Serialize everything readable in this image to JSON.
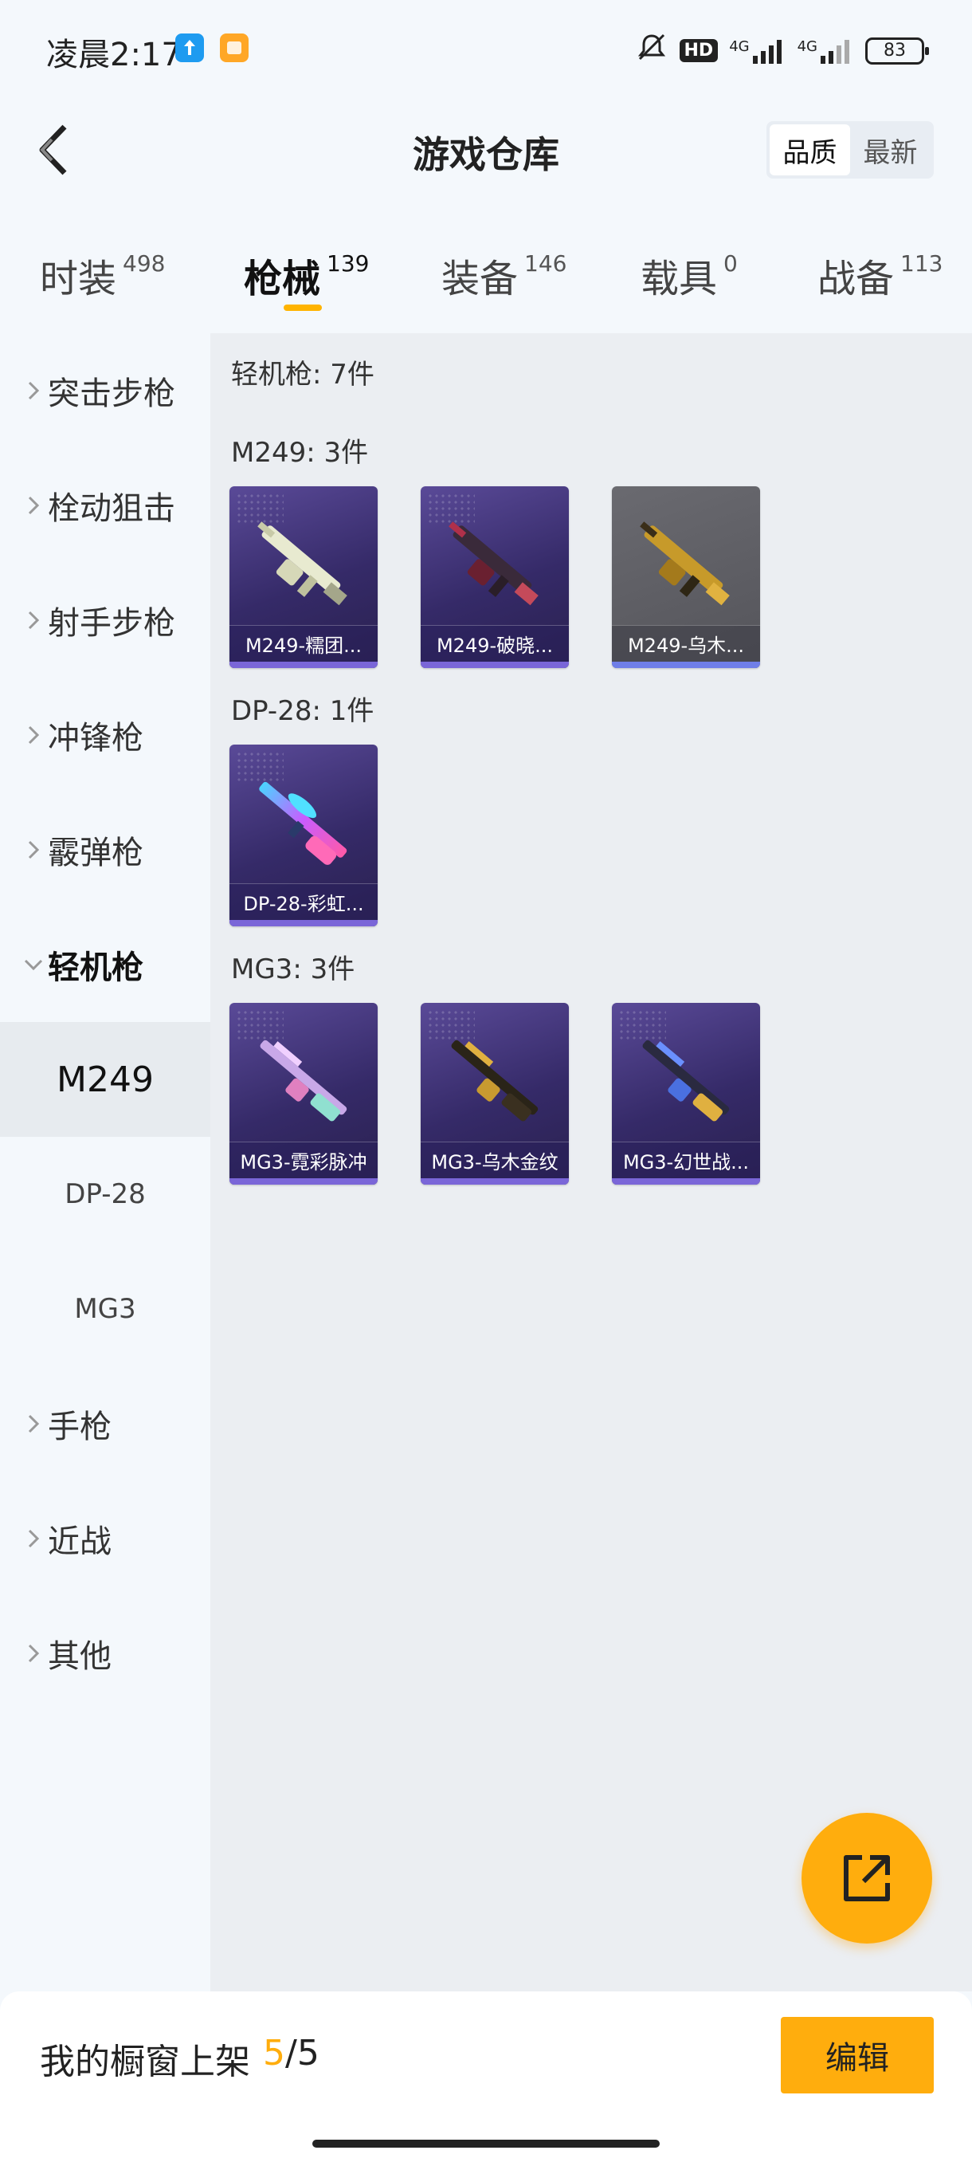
{
  "status": {
    "time": "凌晨2:17",
    "hd": "HD",
    "net1": "4G",
    "net2": "4G",
    "battery": "83"
  },
  "header": {
    "title": "游戏仓库",
    "sort": {
      "quality": "品质",
      "newest": "最新"
    }
  },
  "tabs": [
    {
      "label": "时装",
      "count": "498"
    },
    {
      "label": "枪械",
      "count": "139"
    },
    {
      "label": "装备",
      "count": "146"
    },
    {
      "label": "载具",
      "count": "0"
    },
    {
      "label": "战备",
      "count": "113"
    }
  ],
  "sidebar": {
    "categories": [
      "突击步枪",
      "栓动狙击",
      "射手步枪",
      "冲锋枪",
      "霰弹枪",
      "轻机枪",
      "手枪",
      "近战",
      "其他"
    ],
    "subitems": [
      "M249",
      "DP-28",
      "MG3"
    ]
  },
  "content": {
    "category_header": "轻机枪: 7件",
    "groups": [
      {
        "title": "M249: 3件",
        "items": [
          "M249-糯团...",
          "M249-破晓...",
          "M249-乌木..."
        ]
      },
      {
        "title": "DP-28: 1件",
        "items": [
          "DP-28-彩虹..."
        ]
      },
      {
        "title": "MG3: 3件",
        "items": [
          "MG3-霓彩脉冲",
          "MG3-乌木金纹",
          "MG3-幻世战..."
        ]
      }
    ]
  },
  "bottom": {
    "showcase_label": "我的橱窗上架",
    "showcase_current": "5",
    "showcase_total": "/5",
    "edit_label": "编辑"
  },
  "colors": {
    "accent": "#ffad0d",
    "card_purple": "#352a68",
    "card_gray": "#54545a"
  }
}
